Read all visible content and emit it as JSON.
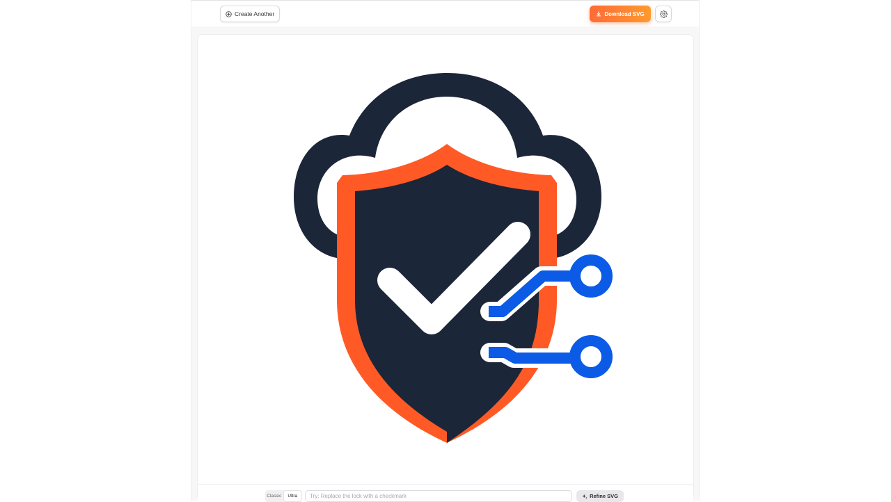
{
  "header": {
    "create_label": "Create Another",
    "download_label": "Download SVG",
    "icons": {
      "create": "plus-circle-icon",
      "download": "download-icon",
      "settings": "gear-icon"
    }
  },
  "artwork": {
    "description_icon": "cloud-shield-checkmark-circuit",
    "colors": {
      "navy": "#1c2639",
      "orange": "#ff5a26",
      "blue": "#0b5be6",
      "white": "#ffffff"
    }
  },
  "footer": {
    "modes": [
      "Classic",
      "Ultra"
    ],
    "active_mode": "Ultra",
    "prompt_value": "",
    "prompt_placeholder": "Try: Replace the lock with a checkmark",
    "refine_label": "Refine SVG",
    "refine_icon": "sparkle-icon"
  },
  "accent": {
    "download_gradient_start": "#ff6b35",
    "download_gradient_end": "#ff9a2e"
  }
}
